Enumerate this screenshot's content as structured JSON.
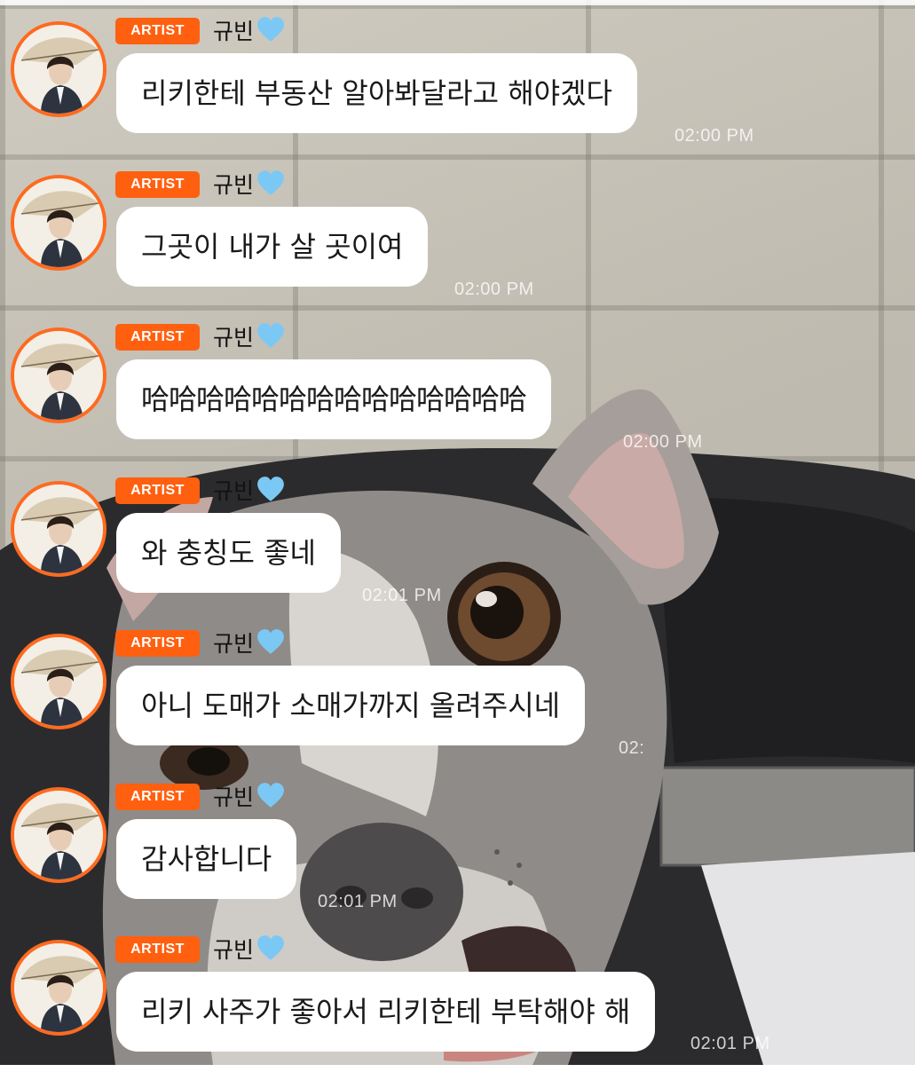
{
  "artist_badge": "ARTIST",
  "messages": [
    {
      "name": "규빈",
      "text": "리키한테 부동산 알아봐달라고 해야겠다",
      "time": "02:00 PM"
    },
    {
      "name": "규빈",
      "text": "그곳이 내가 살 곳이여",
      "time": "02:00 PM"
    },
    {
      "name": "규빈",
      "text": "哈哈哈哈哈哈哈哈哈哈哈哈哈哈",
      "time": "02:00 PM"
    },
    {
      "name": "규빈",
      "text": "와 충칭도 좋네",
      "time": "02:01 PM"
    },
    {
      "name": "규빈",
      "text": "아니 도매가 소매가까지 올려주시네",
      "time": "02:"
    },
    {
      "name": "규빈",
      "text": "감사합니다",
      "time": "02:01 PM"
    },
    {
      "name": "규빈",
      "text": "리키 사주가 좋아서 리키한테 부탁해야 해",
      "time": "02:01 PM"
    }
  ],
  "icons": {
    "heart": "light-blue-heart-icon",
    "avatar": "artist-avatar"
  },
  "colors": {
    "badge": "#ff6010",
    "avatar_ring": "#ff6a1f",
    "heart": "#7cc8f5",
    "bubble": "#ffffff"
  }
}
